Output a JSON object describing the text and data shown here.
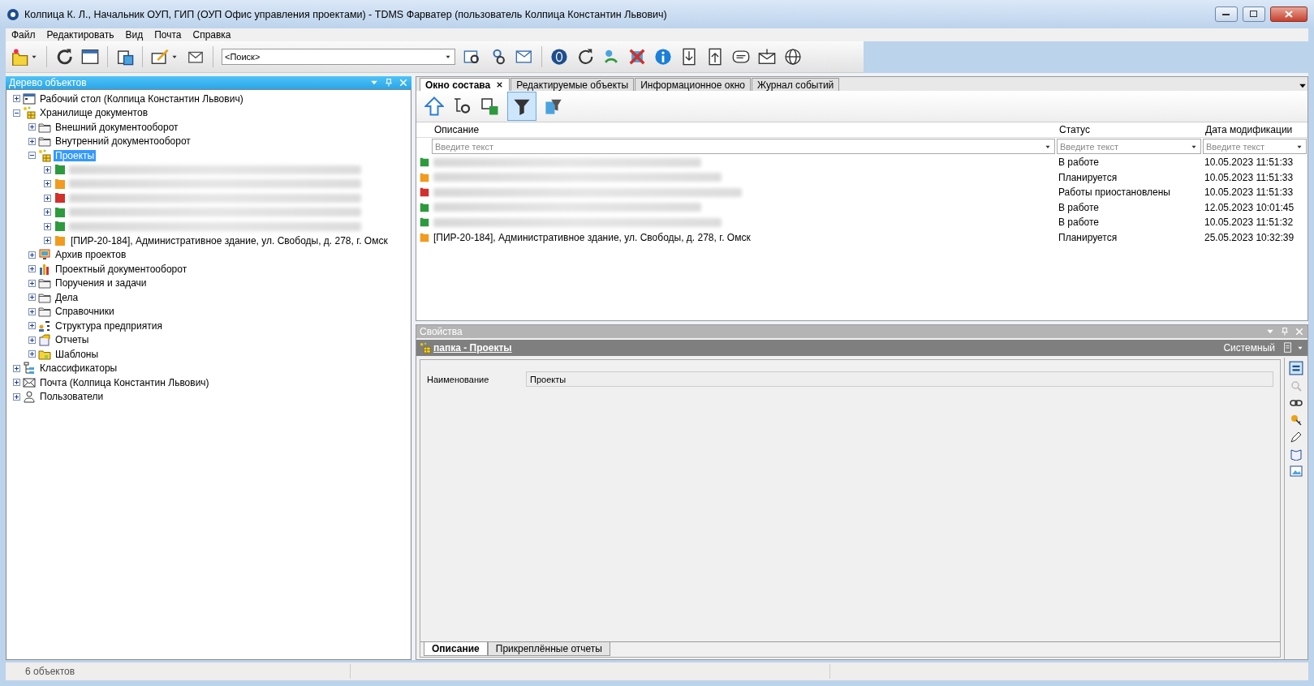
{
  "window": {
    "title": "Колпица К. Л., Начальник ОУП, ГИП (ОУП Офис управления проектами) - TDMS Фарватер (пользователь Колпица Константин Львович)"
  },
  "menu": [
    "Файл",
    "Редактировать",
    "Вид",
    "Почта",
    "Справка"
  ],
  "toolbar": {
    "search": {
      "value": "<Поиск>"
    }
  },
  "tree_panel": {
    "title": "Дерево объектов"
  },
  "tree": [
    {
      "label": "Рабочий стол (Колпица Константин Львович)",
      "kind": "desktop",
      "expanded": false,
      "selected": false
    },
    {
      "label": "Хранилище документов",
      "kind": "storage",
      "expanded": true,
      "selected": false,
      "children": [
        {
          "label": "Внешний документооборот",
          "kind": "folder",
          "expanded": false,
          "selected": false
        },
        {
          "label": "Внутренний документооборот",
          "kind": "folder",
          "expanded": false,
          "selected": false
        },
        {
          "label": "Проекты",
          "kind": "storage",
          "expanded": true,
          "selected": true,
          "children": [
            {
              "kind": "project",
              "color": "#2e9a3e",
              "redacted": true,
              "expanded": false,
              "selected": false
            },
            {
              "kind": "project",
              "color": "#f29b1d",
              "redacted": true,
              "expanded": false,
              "selected": false
            },
            {
              "kind": "project",
              "color": "#d2302a",
              "redacted": true,
              "expanded": false,
              "selected": false
            },
            {
              "kind": "project",
              "color": "#2e9a3e",
              "redacted": true,
              "expanded": false,
              "selected": false
            },
            {
              "kind": "project",
              "color": "#2e9a3e",
              "redacted": true,
              "expanded": false,
              "selected": false
            },
            {
              "label": "[ПИР-20-184], Административное здание, ул. Свободы, д. 278, г. Омск",
              "kind": "project",
              "color": "#f29b1d",
              "redacted": false,
              "expanded": false,
              "selected": false
            }
          ]
        },
        {
          "label": "Архив проектов",
          "kind": "archive",
          "expanded": false,
          "selected": false
        },
        {
          "label": "Проектный документооборот",
          "kind": "chart",
          "expanded": false,
          "selected": false
        },
        {
          "label": "Поручения и задачи",
          "kind": "folder",
          "expanded": false,
          "selected": false
        },
        {
          "label": "Дела",
          "kind": "folder",
          "expanded": false,
          "selected": false
        },
        {
          "label": "Справочники",
          "kind": "folder",
          "expanded": false,
          "selected": false
        },
        {
          "label": "Структура предприятия",
          "kind": "org",
          "expanded": false,
          "selected": false
        },
        {
          "label": "Отчеты",
          "kind": "reports",
          "expanded": false,
          "selected": false
        },
        {
          "label": "Шаблоны",
          "kind": "templates",
          "expanded": false,
          "selected": false
        }
      ]
    },
    {
      "label": "Классификаторы",
      "kind": "classifier",
      "expanded": false,
      "selected": false
    },
    {
      "label": "Почта (Колпица Константин Львович)",
      "kind": "mail",
      "expanded": false,
      "selected": false
    },
    {
      "label": "Пользователи",
      "kind": "users",
      "expanded": false,
      "selected": false
    }
  ],
  "tabs": [
    {
      "label": "Окно состава",
      "selected": true
    },
    {
      "label": "Редактируемые объекты",
      "selected": false
    },
    {
      "label": "Информационное окно",
      "selected": false
    },
    {
      "label": "Журнал событий",
      "selected": false
    }
  ],
  "content_toolbar": {
    "filter_on": true
  },
  "table": {
    "columns": [
      {
        "title": "Описание",
        "placeholder": "Введите текст"
      },
      {
        "title": "Статус",
        "placeholder": "Введите текст"
      },
      {
        "title": "Дата модификации",
        "placeholder": "Введите текст"
      }
    ],
    "rows": [
      {
        "color": "#2e9a3e",
        "redacted": true,
        "status": "В работе",
        "modified": "10.05.2023 11:51:33"
      },
      {
        "color": "#f29b1d",
        "redacted": true,
        "status": "Планируется",
        "modified": "10.05.2023 11:51:33"
      },
      {
        "color": "#d2302a",
        "redacted": true,
        "status": "Работы приостановлены",
        "modified": "10.05.2023 11:51:33"
      },
      {
        "color": "#2e9a3e",
        "redacted": true,
        "status": "В работе",
        "modified": "12.05.2023 10:01:45"
      },
      {
        "color": "#2e9a3e",
        "redacted": true,
        "status": "В работе",
        "modified": "10.05.2023 11:51:32"
      },
      {
        "color": "#f29b1d",
        "redacted": false,
        "description": "[ПИР-20-184], Административное здание, ул. Свободы, д. 278, г. Омск",
        "status": "Планируется",
        "modified": "25.05.2023 10:32:39"
      }
    ]
  },
  "properties": {
    "title": "Свойства",
    "object": "папка - Проекты",
    "mode": "Системный",
    "fields": [
      {
        "label": "Наименование",
        "value": "Проекты"
      }
    ],
    "tabs": [
      {
        "label": "Описание",
        "selected": true
      },
      {
        "label": "Прикреплённые отчеты",
        "selected": false
      }
    ]
  },
  "status_bar": {
    "count": "6 объектов"
  }
}
